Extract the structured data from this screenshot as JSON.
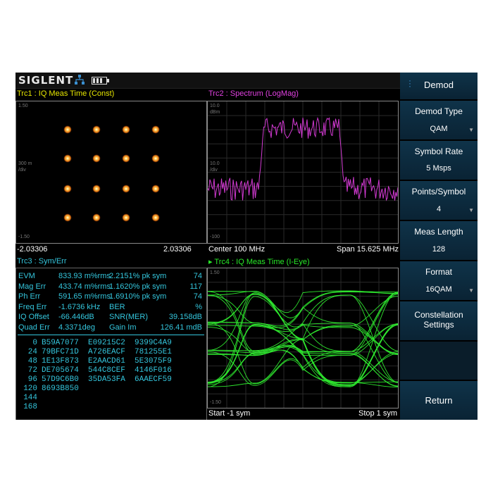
{
  "brand": "SIGLENT",
  "icons": [
    "network-icon",
    "battery-icon"
  ],
  "colors": {
    "trc1": "#e6e600",
    "trc2": "#e040e0",
    "trc3": "#34c6dd",
    "trc4": "#28e828",
    "spectrum": "#d23ad2",
    "eye": "#2ee52e",
    "meas": "#34c6dd"
  },
  "trc1": {
    "title": "Trc1 :  IQ Meas Time  (Const)",
    "y_top": "1.50",
    "y_mid": "300 m",
    "y_div": "/div",
    "y_bottom": "-1.50",
    "x_left": "-2.03306",
    "x_right": "2.03306"
  },
  "trc2": {
    "title": "Trc2 :  Spectrum  (LogMag)",
    "y_top": "10.0",
    "y_unit": "dBm",
    "y_mid": "10.0",
    "y_div": "/div",
    "y_bottom": "-100",
    "x_left": "Center 100 MHz",
    "x_right": "Span 15.625 MHz"
  },
  "trc3": {
    "title": "Trc3 :  Sym/Err",
    "meas": [
      {
        "label": "EVM",
        "val1": "833.93 m%rms",
        "val2": "2.2151% pk sym",
        "val3": "74"
      },
      {
        "label": "Mag Err",
        "val1": "433.74 m%rms",
        "val2": "1.1620% pk sym",
        "val3": "117"
      },
      {
        "label": "Ph Err",
        "val1": "591.65 m%rms",
        "val2": "1.6910% pk sym",
        "val3": "74"
      },
      {
        "label": "Freq Err",
        "val1": "-1.6736 kHz",
        "val2": "BER",
        "val3": "%"
      },
      {
        "label": "IQ Offset",
        "val1": "-66.446dB",
        "val2": "SNR(MER)",
        "val3": "39.158dB"
      },
      {
        "label": "Quad Err",
        "val1": "4.3371deg",
        "val2": "Gain Im",
        "val3": "126.41 mdB"
      }
    ],
    "symbols": [
      {
        "idx": "0",
        "data": "B59A7077  E09215C2  9399C4A9"
      },
      {
        "idx": "24",
        "data": "79BFC71D  A726EACF  781255E1"
      },
      {
        "idx": "48",
        "data": "1E13F873  E2AACD61  5E3075F9"
      },
      {
        "idx": "72",
        "data": "DE705674  544C8CEF  4146F016"
      },
      {
        "idx": "96",
        "data": "57D9C6B0  35DA53FA  6AAECF59"
      },
      {
        "idx": "120",
        "data": "8693B850"
      },
      {
        "idx": "144",
        "data": ""
      },
      {
        "idx": "168",
        "data": ""
      }
    ]
  },
  "trc4": {
    "title": "Trc4 :  IQ Meas Time  (I-Eye)",
    "y_top": "1.50",
    "y_bottom": "-1.50",
    "x_left": "Start -1 sym",
    "x_right": "Stop 1 sym"
  },
  "softkeys": {
    "menu": "Demod",
    "demod_type": {
      "label": "Demod Type",
      "value": "QAM"
    },
    "symbol_rate": {
      "label": "Symbol Rate",
      "value": "5 Msps"
    },
    "points_symbol": {
      "label": "Points/Symbol",
      "value": "4"
    },
    "meas_length": {
      "label": "Meas Length",
      "value": "128"
    },
    "format": {
      "label": "Format",
      "value": "16QAM"
    },
    "constellation": {
      "label1": "Constellation",
      "label2": "Settings"
    },
    "return": "Return"
  }
}
